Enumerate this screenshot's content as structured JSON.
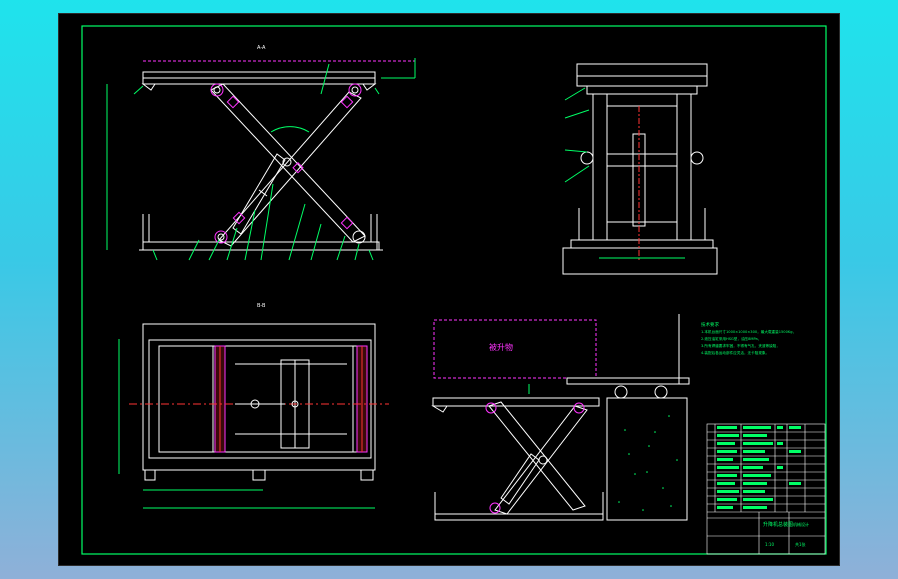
{
  "drawing": {
    "front_view_label": "A-A",
    "plan_view_label": "B-B",
    "load_box_label": "被升物",
    "tech_notes": {
      "title": "技术要求",
      "lines": [
        "1.本机台面尺寸1000×1000×300，最大载重量1500Kg，",
        "2.液压油缸采用HSG型，油压8MPa，",
        "3.所有焊缝要求牢固，不得有气孔、夹渣等缺陷，",
        "4.装配后各运动部件应灵活，无卡阻现象。"
      ]
    },
    "title_block": {
      "drawing_name": "升降机总装图",
      "company": "机械设计",
      "scale": "1:10",
      "sheet": "共1张"
    },
    "colors": {
      "sheet_bg": "#000000",
      "border": "#00ff66",
      "geometry": "#ffffff",
      "dimension": "#00ff66",
      "centerline": "#ff3333",
      "highlight": "#ff33ff",
      "accent_blue": "#66aaff"
    }
  }
}
